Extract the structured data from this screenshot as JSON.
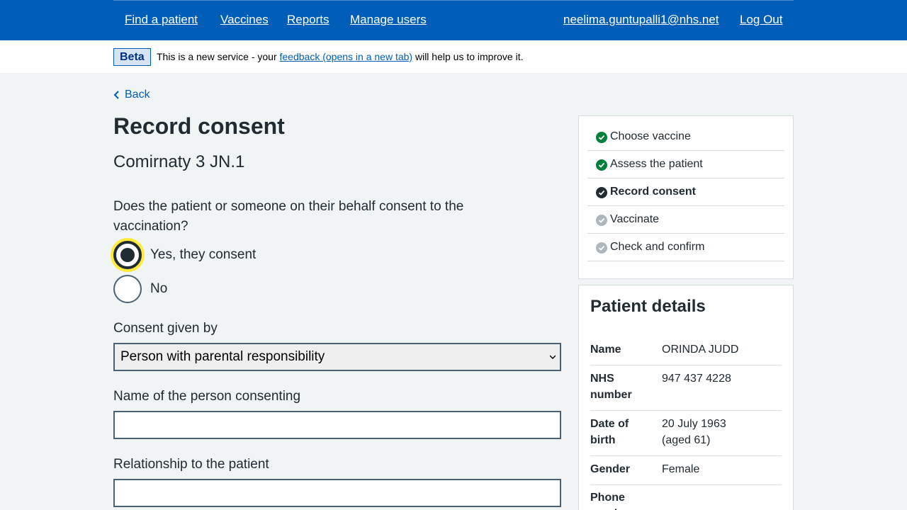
{
  "nav": {
    "find_patient": "Find a patient",
    "vaccines": "Vaccines",
    "reports": "Reports",
    "manage_users": "Manage users",
    "user_email": "neelima.guntupalli1@nhs.net",
    "log_out": "Log Out"
  },
  "beta": {
    "tag": "Beta",
    "text_before": "This is a new service - your ",
    "link": "feedback (opens in a new tab)",
    "text_after": " will help us to improve it."
  },
  "back_label": "Back",
  "page_title": "Record consent",
  "vaccine_name": "Comirnaty 3 JN.1",
  "consent_question": "Does the patient or someone on their behalf consent to the vaccination?",
  "consent_options": [
    {
      "label": "Yes, they consent",
      "selected": true
    },
    {
      "label": "No",
      "selected": false
    }
  ],
  "consent_given_by": {
    "label": "Consent given by",
    "selected": "Person with parental responsibility"
  },
  "person_name": {
    "label": "Name of the person consenting",
    "value": ""
  },
  "relationship": {
    "label": "Relationship to the patient",
    "value": ""
  },
  "steps": [
    {
      "label": "Choose vaccine",
      "status": "complete"
    },
    {
      "label": "Assess the patient",
      "status": "complete"
    },
    {
      "label": "Record consent",
      "status": "current"
    },
    {
      "label": "Vaccinate",
      "status": "pending"
    },
    {
      "label": "Check and confirm",
      "status": "pending"
    }
  ],
  "patient_details": {
    "title": "Patient details",
    "rows": [
      {
        "key": "Name",
        "value": "ORINDA JUDD"
      },
      {
        "key": "NHS number",
        "value": "947 437 4228"
      },
      {
        "key": "Date of birth",
        "value": "20 July 1963 (aged 61)"
      },
      {
        "key": "Gender",
        "value": "Female"
      },
      {
        "key": "Phone number",
        "value": ""
      }
    ]
  },
  "colors": {
    "header_blue": "#005eb8",
    "complete_green": "#007f3b",
    "current_dark": "#212b32",
    "pending_grey": "#aeb7bd",
    "focus_yellow": "#ffeb3b"
  }
}
